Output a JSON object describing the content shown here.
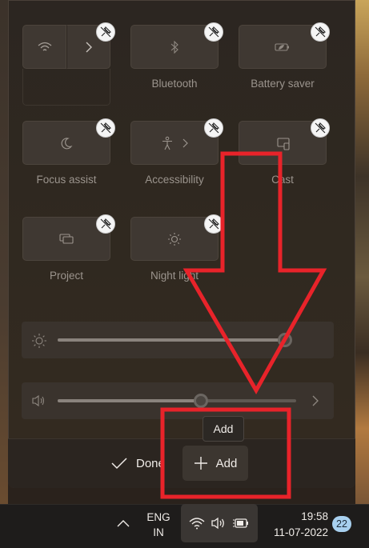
{
  "tiles": [
    {
      "id": "wifi",
      "label": "",
      "icon": "wifi-icon",
      "split": true
    },
    {
      "id": "bluetooth",
      "label": "Bluetooth",
      "icon": "bluetooth-icon"
    },
    {
      "id": "battery-saver",
      "label": "Battery saver",
      "icon": "battery-saver-icon"
    },
    {
      "id": "focus-assist",
      "label": "Focus assist",
      "icon": "moon-icon"
    },
    {
      "id": "accessibility",
      "label": "Accessibility",
      "icon": "accessibility-icon",
      "chevron": true
    },
    {
      "id": "cast",
      "label": "Cast",
      "icon": "cast-icon"
    },
    {
      "id": "project",
      "label": "Project",
      "icon": "project-icon"
    },
    {
      "id": "night-light",
      "label": "Night light",
      "icon": "night-light-icon"
    }
  ],
  "brightness": {
    "level": 0.98,
    "icon": "sun-icon"
  },
  "volume": {
    "level": 0.6,
    "icon": "speaker-icon"
  },
  "footer": {
    "done_label": "Done",
    "add_label": "Add",
    "tooltip": "Add"
  },
  "taskbar": {
    "lang_line1": "ENG",
    "lang_line2": "IN",
    "time": "19:58",
    "date": "11-07-2022",
    "notification_count": "22"
  },
  "annotation": {
    "color": "#e8232a"
  }
}
